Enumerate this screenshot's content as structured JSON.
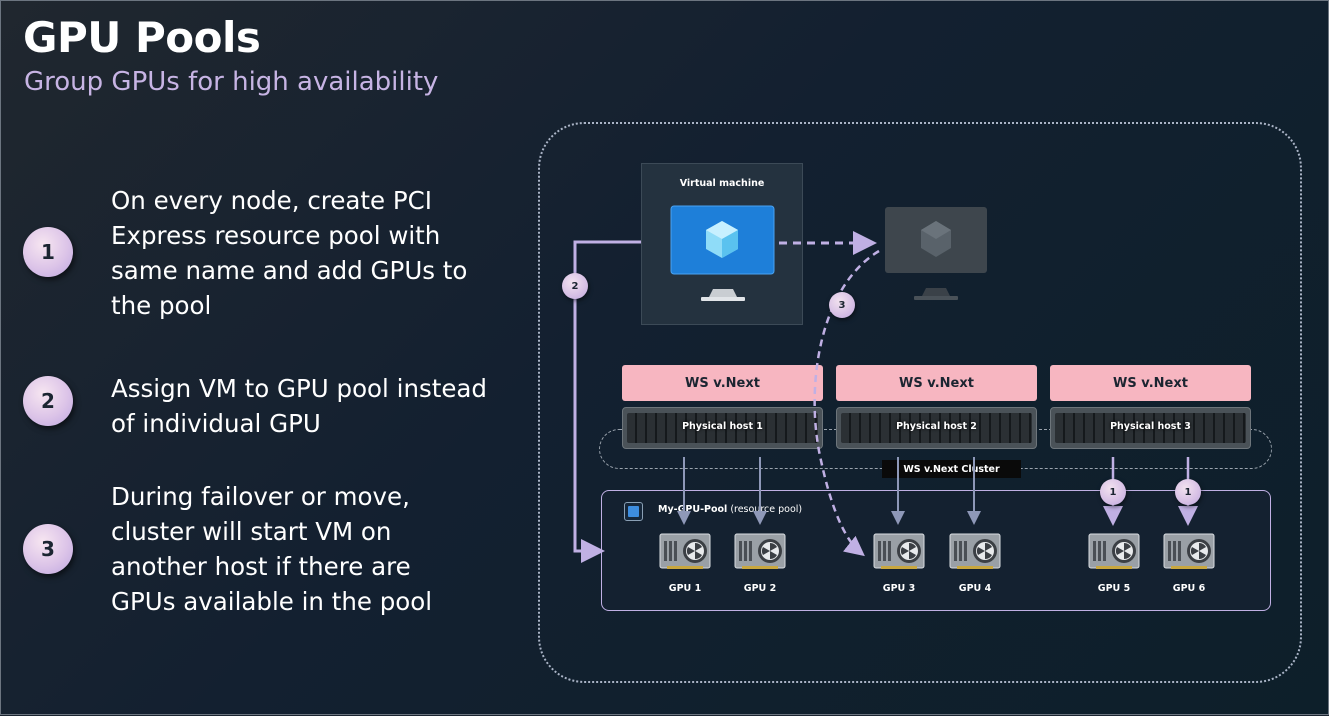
{
  "slide": {
    "title": "GPU Pools",
    "subtitle": "Group GPUs for high availability"
  },
  "steps": [
    {
      "number": "1",
      "text": "On every node, create PCI Express resource pool with same name and add GPUs to the pool"
    },
    {
      "number": "2",
      "text": "Assign VM to GPU pool instead of individual GPU"
    },
    {
      "number": "3",
      "text": "During failover or move, cluster will start VM on another host if there are GPUs available in the pool"
    }
  ],
  "diagram": {
    "vm_label": "Virtual machine",
    "hosts": [
      {
        "os_label": "WS v.Next",
        "host_label": "Physical host 1"
      },
      {
        "os_label": "WS v.Next",
        "host_label": "Physical host 2"
      },
      {
        "os_label": "WS v.Next",
        "host_label": "Physical host 3"
      }
    ],
    "cluster_label": "WS v.Next Cluster",
    "pool_name": "My-GPU-Pool",
    "pool_suffix": "(resource pool)",
    "gpus": [
      "GPU 1",
      "GPU 2",
      "GPU 3",
      "GPU 4",
      "GPU 5",
      "GPU 6"
    ],
    "markers": {
      "assign": "2",
      "move": "3",
      "add1": "1",
      "add2": "1"
    },
    "colors": {
      "accent_purple": "#c7b4e4",
      "host_pink": "#f7b6c1",
      "vm_blue": "#1e7fd9",
      "arrow_lavender": "#c0b0e4",
      "arrow_gray": "#8e98b8"
    }
  }
}
